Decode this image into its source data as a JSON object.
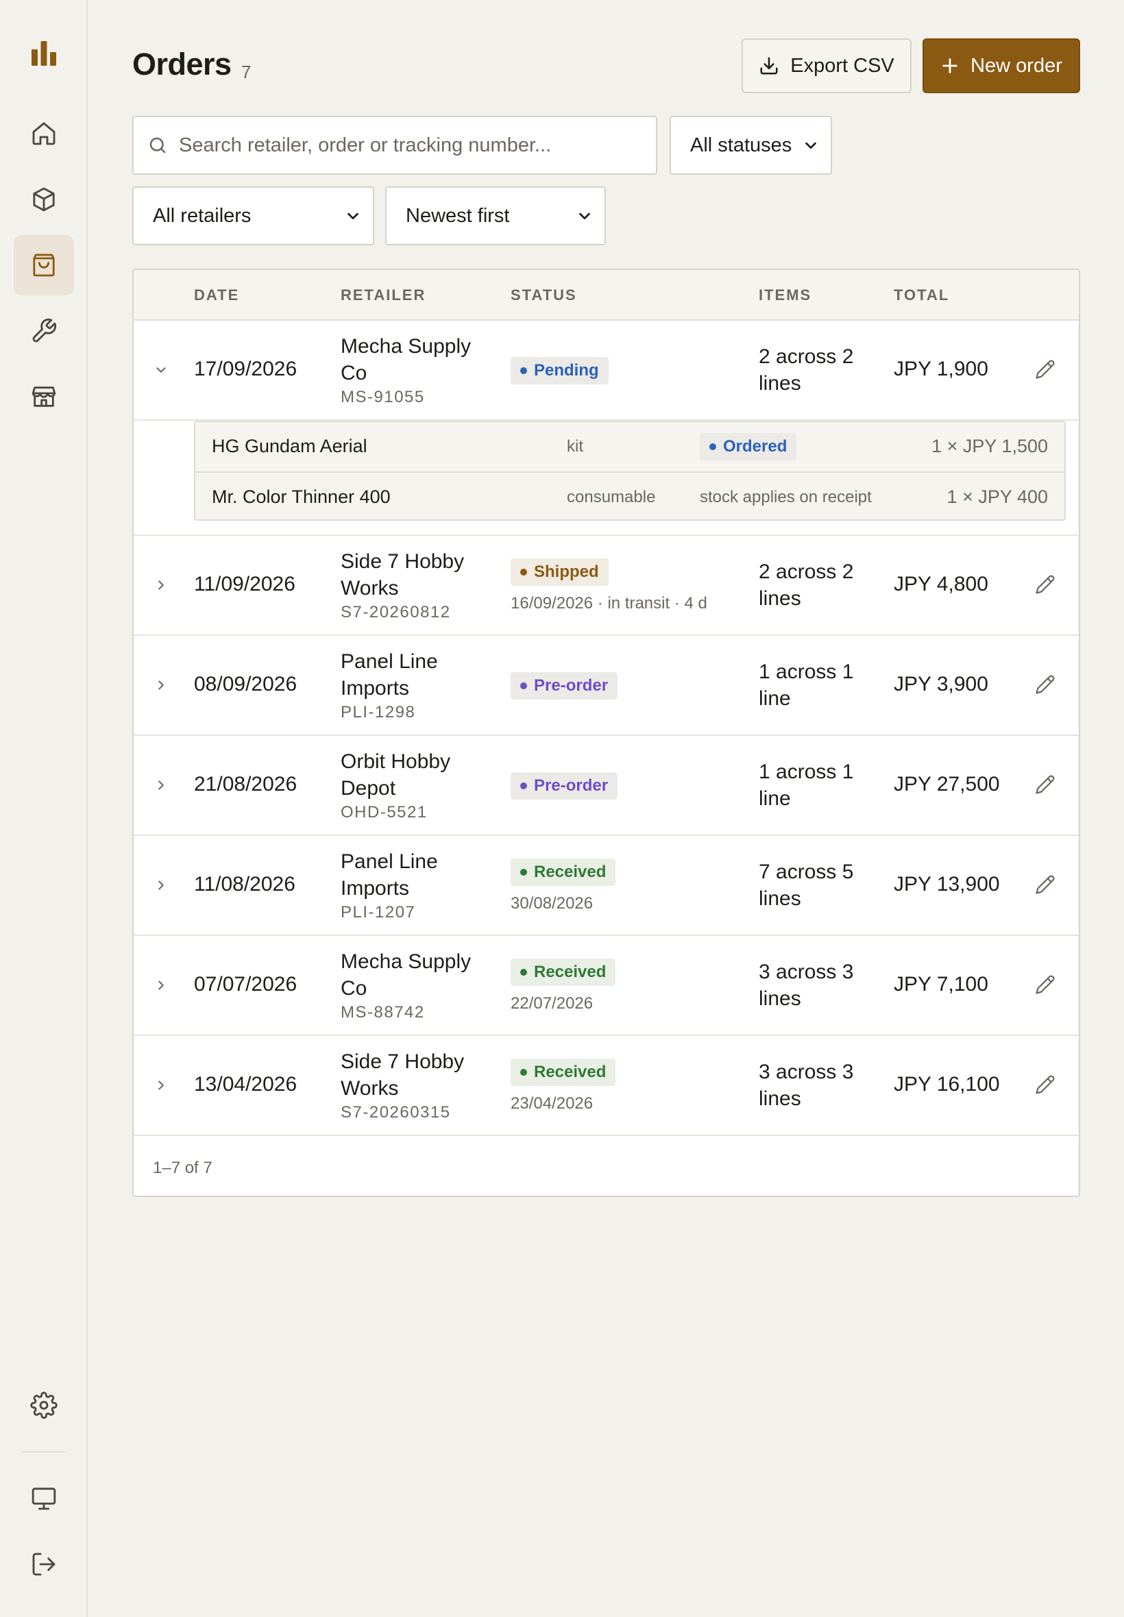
{
  "page": {
    "title": "Orders",
    "count": "7"
  },
  "toolbar": {
    "export_label": "Export CSV",
    "new_label": "New order"
  },
  "filters": {
    "search_placeholder": "Search retailer, order or tracking number...",
    "status": "All statuses",
    "retailer": "All retailers",
    "sort": "Newest first"
  },
  "table": {
    "columns": [
      "DATE",
      "RETAILER",
      "STATUS",
      "ITEMS",
      "TOTAL"
    ],
    "rows": [
      {
        "date": "17/09/2026",
        "retailer": "Mecha Supply Co",
        "order_id": "MS-91055",
        "status": "Pending",
        "status_sub": "",
        "items": "2 across 2 lines",
        "total": "JPY 1,900"
      },
      {
        "date": "11/09/2026",
        "retailer": "Side 7 Hobby Works",
        "order_id": "S7-20260812",
        "status": "Shipped",
        "status_sub": "16/09/2026 · in transit · 4 d",
        "items": "2 across 2 lines",
        "total": "JPY 4,800"
      },
      {
        "date": "08/09/2026",
        "retailer": "Panel Line Imports",
        "order_id": "PLI-1298",
        "status": "Pre-order",
        "status_sub": "",
        "items": "1 across 1 line",
        "total": "JPY 3,900"
      },
      {
        "date": "21/08/2026",
        "retailer": "Orbit Hobby Depot",
        "order_id": "OHD-5521",
        "status": "Pre-order",
        "status_sub": "",
        "items": "1 across 1 line",
        "total": "JPY 27,500"
      },
      {
        "date": "11/08/2026",
        "retailer": "Panel Line Imports",
        "order_id": "PLI-1207",
        "status": "Received",
        "status_sub": "30/08/2026",
        "items": "7 across 5 lines",
        "total": "JPY 13,900"
      },
      {
        "date": "07/07/2026",
        "retailer": "Mecha Supply Co",
        "order_id": "MS-88742",
        "status": "Received",
        "status_sub": "22/07/2026",
        "items": "3 across 3 lines",
        "total": "JPY 7,100"
      },
      {
        "date": "13/04/2026",
        "retailer": "Side 7 Hobby Works",
        "order_id": "S7-20260315",
        "status": "Received",
        "status_sub": "23/04/2026",
        "items": "3 across 3 lines",
        "total": "JPY 16,100"
      }
    ],
    "expanded_lines": [
      {
        "name": "HG Gundam Aerial",
        "category": "kit",
        "status": "Ordered",
        "note": "",
        "qty": "1 × JPY 1,500"
      },
      {
        "name": "Mr. Color Thinner 400",
        "category": "consumable",
        "status": "",
        "note": "stock applies on receipt",
        "qty": "1 × JPY 400"
      }
    ],
    "footer": "1–7 of 7"
  },
  "sidebar": {
    "items": [
      "logo-icon",
      "home-icon",
      "box-icon",
      "bag-icon",
      "wrench-icon",
      "store-icon",
      "gear-icon",
      "monitor-icon",
      "logout-icon"
    ],
    "active": "bag-icon"
  },
  "colors": {
    "accent": "#8b5a12",
    "pending": "#2c62b8",
    "preorder": "#6b4fc8",
    "received": "#2f7a35"
  }
}
